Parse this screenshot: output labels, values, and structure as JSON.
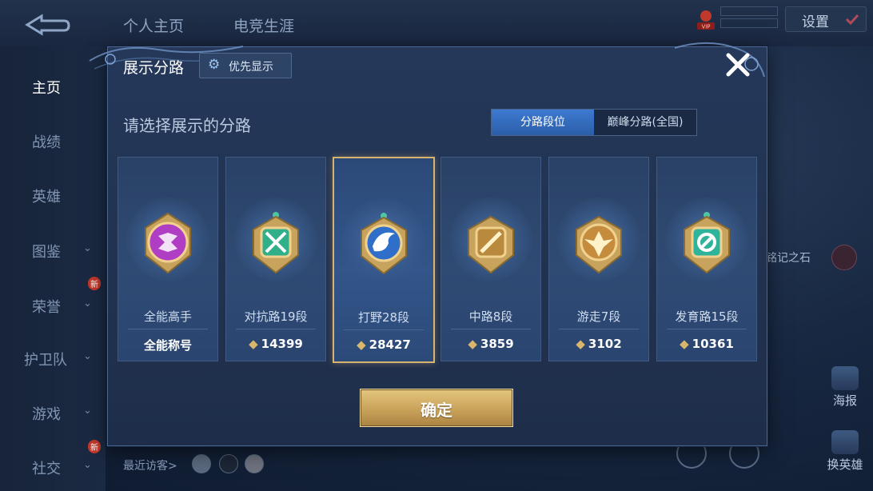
{
  "header": {
    "tabs": [
      "个人主页",
      "电竞生涯"
    ],
    "settings_label": "设置",
    "vip_label": "VIP"
  },
  "sidebar": {
    "items": [
      {
        "label": "主页",
        "expandable": false,
        "new": false
      },
      {
        "label": "战绩",
        "expandable": false,
        "new": false
      },
      {
        "label": "英雄",
        "expandable": false,
        "new": false
      },
      {
        "label": "图鉴",
        "expandable": true,
        "new": false
      },
      {
        "label": "荣誉",
        "expandable": true,
        "new": true
      },
      {
        "label": "护卫队",
        "expandable": true,
        "new": false
      },
      {
        "label": "游戏",
        "expandable": true,
        "new": false
      },
      {
        "label": "社交",
        "expandable": true,
        "new": true
      }
    ],
    "new_badge": "新"
  },
  "right_panel": {
    "stone_label": "铭记之石",
    "poster_label": "海报",
    "switch_hero_label": "换英雄"
  },
  "footer": {
    "recent_visitors_label": "最近访客>"
  },
  "dialog": {
    "title": "展示分路",
    "priority_button": "优先显示",
    "subtitle": "请选择展示的分路",
    "segment": {
      "option_a": "分路段位",
      "option_b": "巅峰分路(全国)",
      "selected": "分路段位"
    },
    "cards": [
      {
        "lane": "全能高手",
        "score": "全能称号",
        "emblem_color": "#b03ec4",
        "selected": false,
        "has_points_icon": false
      },
      {
        "lane": "对抗路19段",
        "score": "14399",
        "emblem_color": "#2fb08a",
        "selected": false,
        "has_points_icon": true
      },
      {
        "lane": "打野28段",
        "score": "28427",
        "emblem_color": "#2f6fc9",
        "selected": true,
        "has_points_icon": true
      },
      {
        "lane": "中路8段",
        "score": "3859",
        "emblem_color": "#b98a3e",
        "selected": false,
        "has_points_icon": true
      },
      {
        "lane": "游走7段",
        "score": "3102",
        "emblem_color": "#c48c3c",
        "selected": false,
        "has_points_icon": true
      },
      {
        "lane": "发育路15段",
        "score": "10361",
        "emblem_color": "#2fb49c",
        "selected": false,
        "has_points_icon": true
      }
    ],
    "confirm_label": "确定"
  },
  "colors": {
    "accent_gold": "#d6b36f",
    "segment_active": "#3d7ad1",
    "dialog_bg": "#23365a"
  }
}
